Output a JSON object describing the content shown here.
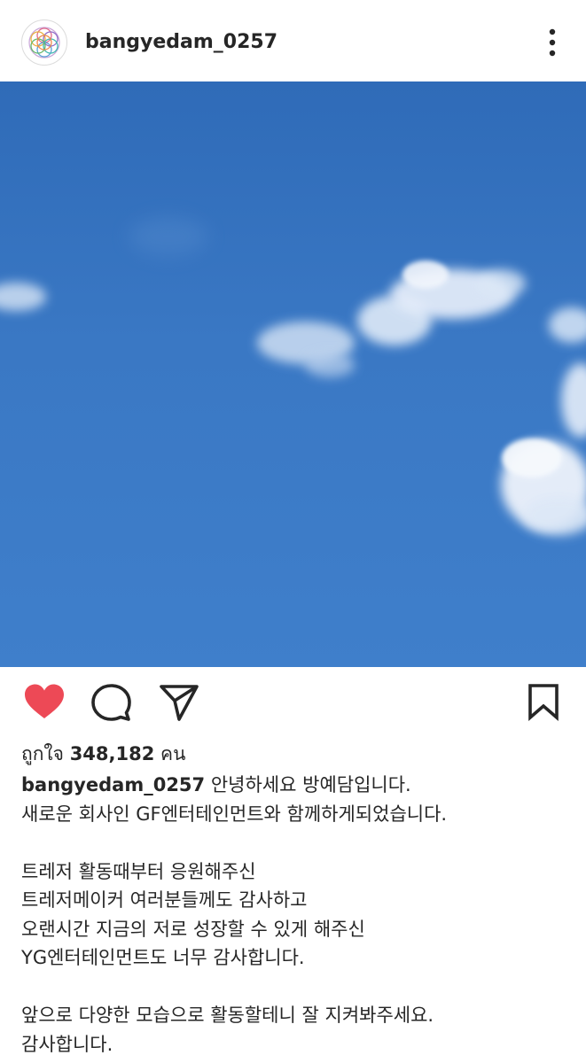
{
  "post": {
    "username": "bangyedam_0257",
    "avatar_icon": "flower-of-life-icon",
    "more_icon": "more-vertical-icon"
  },
  "image": {
    "description_color": "#3573c0"
  },
  "actions": {
    "like_icon": "heart-filled-icon",
    "comment_icon": "comment-icon",
    "share_icon": "paper-plane-icon",
    "save_icon": "bookmark-icon",
    "like_color": "#ed4956"
  },
  "likes": {
    "prefix": "ถูกใจ",
    "count": "348,182",
    "suffix": "คน"
  },
  "caption": {
    "username": "bangyedam_0257",
    "lines": [
      "안녕하세요 방예담입니다.",
      "새로운 회사인 GF엔터테인먼트와 함께하게되었습니다.",
      "",
      "트레저 활동때부터 응원해주신",
      "트레저메이커 여러분들께도 감사하고",
      "오랜시간 지금의 저로 성장할 수 있게 해주신",
      "YG엔터테인먼트도 너무 감사합니다.",
      "",
      "앞으로 다양한 모습으로 활동할테니 잘 지켜봐주세요.",
      "감사합니다."
    ]
  }
}
